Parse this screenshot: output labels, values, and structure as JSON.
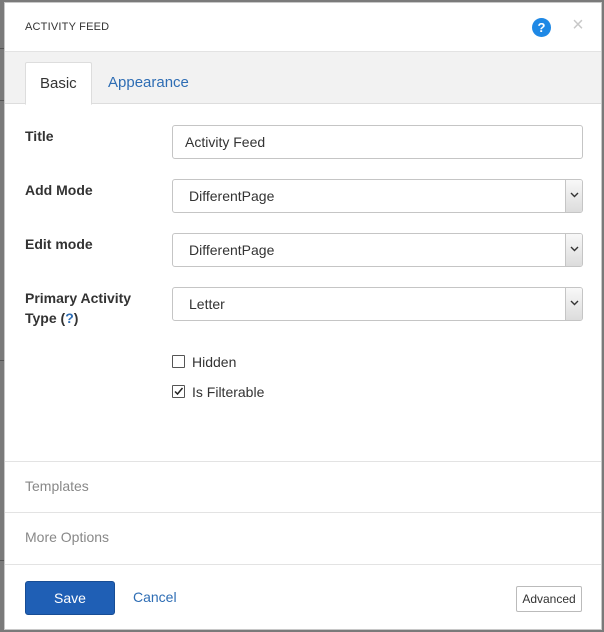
{
  "dialog": {
    "title": "ACTIVITY FEED",
    "help_icon_glyph": "?",
    "close_icon_glyph": "×"
  },
  "tabs": [
    {
      "label": "Basic",
      "active": true
    },
    {
      "label": "Appearance",
      "active": false
    }
  ],
  "form": {
    "title": {
      "label": "Title",
      "value": "Activity Feed"
    },
    "add_mode": {
      "label": "Add Mode",
      "value": "DifferentPage"
    },
    "edit_mode": {
      "label": "Edit mode",
      "value": "DifferentPage"
    },
    "primary_activity_type": {
      "label_line1": "Primary Activity",
      "label_line2_prefix": "Type (",
      "label_help": "?",
      "label_line2_suffix": ")",
      "value": "Letter"
    },
    "hidden": {
      "label": "Hidden",
      "checked": false
    },
    "is_filterable": {
      "label": "Is Filterable",
      "checked": true
    }
  },
  "sections": {
    "templates": "Templates",
    "more_options": "More Options"
  },
  "footer": {
    "save_label": "Save",
    "cancel_label": "Cancel",
    "advanced_label": "Advanced"
  },
  "colors": {
    "accent": "#1f5fb5",
    "link": "#2e6db4",
    "help_icon": "#1e88e5"
  }
}
